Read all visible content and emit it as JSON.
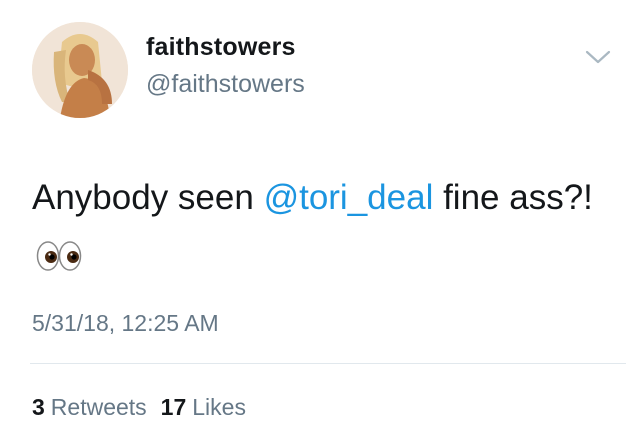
{
  "user": {
    "display_name": "faithstowers",
    "handle": "@faithstowers"
  },
  "tweet": {
    "text_before": "Anybody seen ",
    "mention": "@tori_deal",
    "text_after": " fine ass?!",
    "emoji": "eyes-emoji"
  },
  "timestamp": "5/31/18, 12:25 AM",
  "stats": {
    "retweets_count": "3",
    "retweets_label": "Retweets",
    "likes_count": "17",
    "likes_label": "Likes"
  },
  "icons": {
    "menu": "chevron-down-icon"
  },
  "colors": {
    "link": "#1b95e0",
    "secondary_text": "#657786",
    "primary_text": "#14171a"
  }
}
